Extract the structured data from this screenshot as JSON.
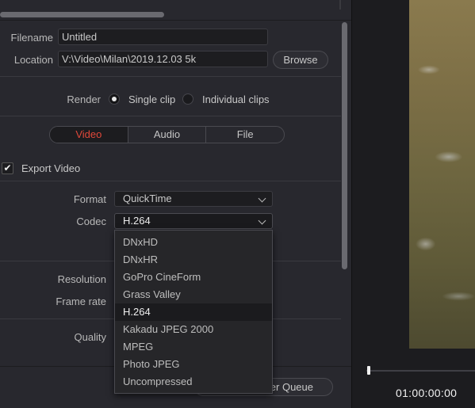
{
  "file": {
    "filename_label": "Filename",
    "filename_value": "Untitled",
    "location_label": "Location",
    "location_value": "V:\\Video\\Milan\\2019.12.03 5k",
    "browse_label": "Browse"
  },
  "render": {
    "label": "Render",
    "options": [
      "Single clip",
      "Individual clips"
    ],
    "selected": "Single clip"
  },
  "tabs": [
    {
      "label": "Video",
      "active": true
    },
    {
      "label": "Audio",
      "active": false
    },
    {
      "label": "File",
      "active": false
    }
  ],
  "export_video": {
    "label": "Export Video",
    "checked": true
  },
  "format": {
    "label": "Format",
    "value": "QuickTime"
  },
  "codec": {
    "label": "Codec",
    "value": "H.264",
    "options": [
      "DNxHD",
      "DNxHR",
      "GoPro CineForm",
      "Grass Valley",
      "H.264",
      "Kakadu JPEG 2000",
      "MPEG",
      "Photo JPEG",
      "Uncompressed"
    ]
  },
  "labels": {
    "resolution": "Resolution",
    "frame_rate": "Frame rate",
    "quality": "Quality"
  },
  "queue_button_partial": "er Queue",
  "viewer": {
    "timecode": "01:00:00:00"
  },
  "colors": {
    "accent_active_tab": "#e0483a",
    "panel_bg": "#28282e"
  }
}
